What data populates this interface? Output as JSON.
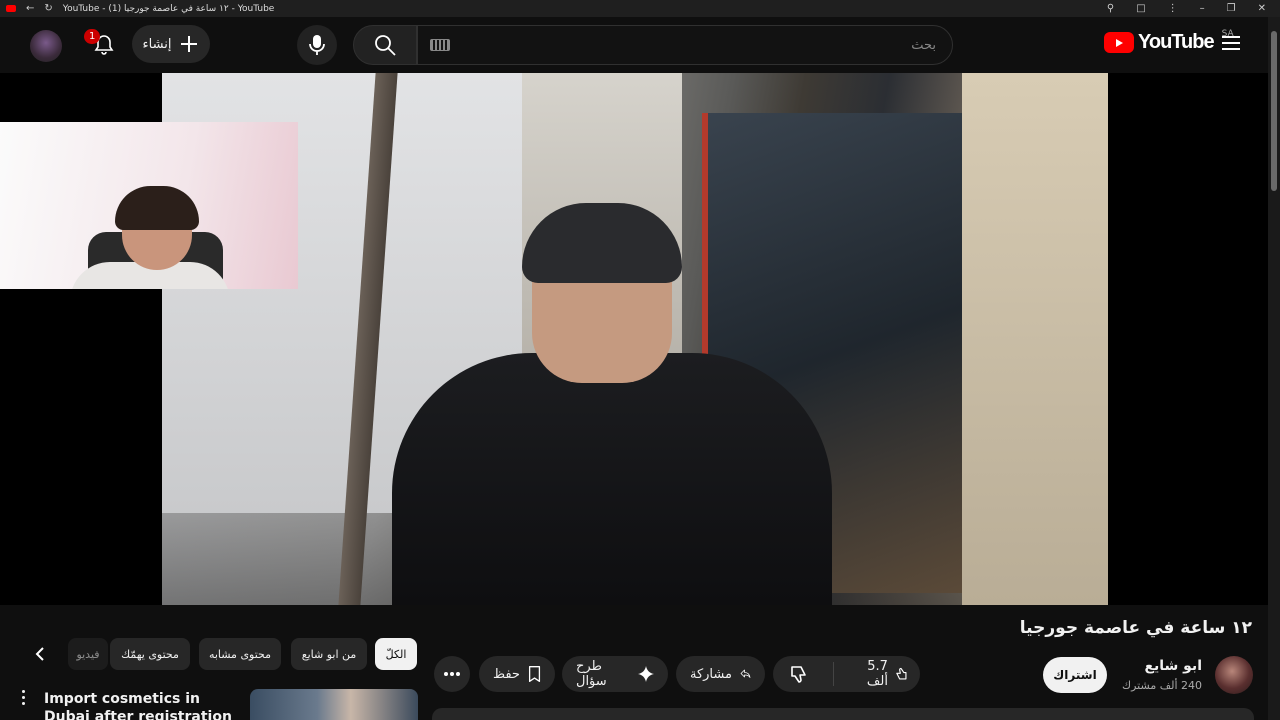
{
  "browser": {
    "tab_title": "YouTube - ١٢ ساعة في عاصمة جورجيا (1) - YouTube"
  },
  "masthead": {
    "create_label": "إنشاء",
    "notification_count": "1",
    "search_placeholder": "بحث",
    "logo_text": "YouTube",
    "country_code": "SA"
  },
  "video": {
    "title": "١٢ ساعة في عاصمة جورجيا",
    "channel_name": "ابو شايع",
    "subscribers": "240 ألف مشترك",
    "subscribe_label": "اشتراك",
    "likes": "5.7 ألف",
    "share_label": "مشاركة",
    "ask_label": "طرح سؤال",
    "save_label": "حفظ"
  },
  "chips": [
    {
      "label": "الكلّ",
      "active": true
    },
    {
      "label": "من ابو شايع",
      "active": false
    },
    {
      "label": "محتوى مشابه",
      "active": false
    },
    {
      "label": "محتوى يهمّك",
      "active": false
    },
    {
      "label": "فيديو",
      "active": false
    }
  ],
  "recommendation": {
    "title": "Import cosmetics in Dubai after registration One stop guide to"
  },
  "colors": {
    "brand_red": "#ff0000",
    "background": "#0f0f0f",
    "pill": "#272727"
  },
  "icons": [
    "back-arrow-icon",
    "reload-icon",
    "zoom-icon",
    "extension-icon",
    "kebab-menu-icon",
    "bell-icon",
    "plus-icon",
    "mic-icon",
    "search-icon",
    "keyboard-icon",
    "hamburger-menu-icon",
    "like-icon",
    "dislike-icon",
    "share-icon",
    "sparkle-icon",
    "bookmark-icon",
    "more-icon",
    "chevron-left-icon"
  ]
}
